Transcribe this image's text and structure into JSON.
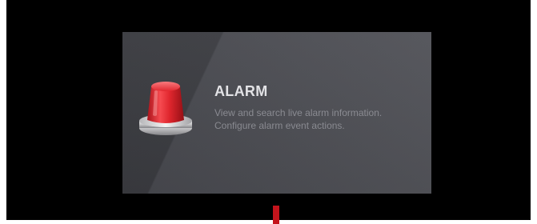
{
  "tile": {
    "title": "ALARM",
    "description_lines": [
      "View and search live alarm information.",
      "Configure alarm event actions."
    ],
    "icon": "alarm-beacon-icon"
  },
  "colors": {
    "background": "#000000",
    "tile": "#4a4b51",
    "title": "#e9e9ec",
    "description": "#8e8f96",
    "beacon_red": "#e8242c",
    "indicator": "#c4141c"
  }
}
